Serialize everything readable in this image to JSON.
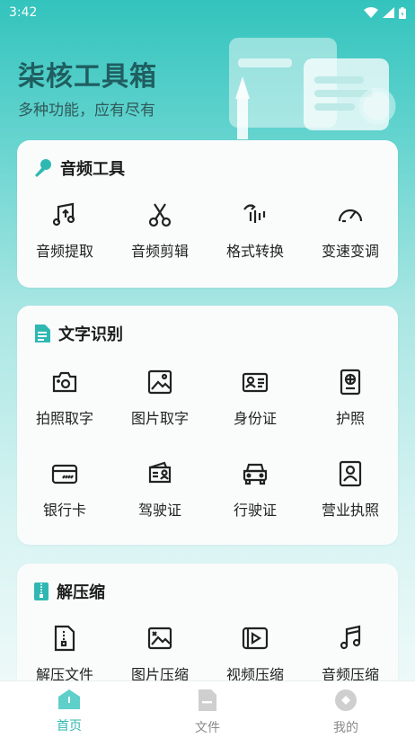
{
  "status": {
    "time": "3:42"
  },
  "hero": {
    "title": "柒核工具箱",
    "subtitle": "多种功能，应有尽有"
  },
  "sections": [
    {
      "title": "音频工具",
      "items": [
        "音频提取",
        "音频剪辑",
        "格式转换",
        "变速变调"
      ]
    },
    {
      "title": "文字识别",
      "items": [
        "拍照取字",
        "图片取字",
        "身份证",
        "护照",
        "银行卡",
        "驾驶证",
        "行驶证",
        "营业执照"
      ]
    },
    {
      "title": "解压缩",
      "items": [
        "解压文件",
        "图片压缩",
        "视频压缩",
        "音频压缩"
      ]
    }
  ],
  "tabs": [
    {
      "label": "首页",
      "active": true
    },
    {
      "label": "文件",
      "active": false
    },
    {
      "label": "我的",
      "active": false
    }
  ],
  "colors": {
    "accent": "#2fb8b2",
    "title": "#1f5e60",
    "inactive_tab": "#8a8a8a"
  }
}
